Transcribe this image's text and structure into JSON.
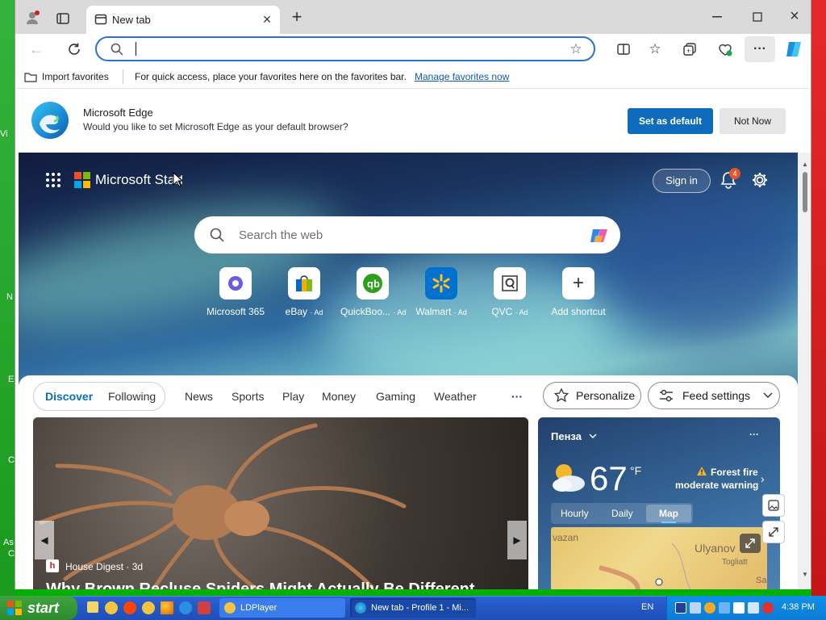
{
  "browser": {
    "tab_title": "New tab",
    "address_value": "",
    "favorites_bar": {
      "import_label": "Import favorites",
      "message": "For quick access, place your favorites here on the favorites bar.",
      "manage_link": "Manage favorites now"
    },
    "default_prompt": {
      "title": "Microsoft Edge",
      "message": "Would you like to set Microsoft Edge as your default browser?",
      "set_default_label": "Set as default",
      "not_now_label": "Not Now"
    }
  },
  "newtab": {
    "brand": "Microsoft Start",
    "sign_in_label": "Sign in",
    "notification_count": "4",
    "search_placeholder": "Search the web",
    "shortcuts": [
      {
        "label": "Microsoft 365",
        "ad": ""
      },
      {
        "label": "eBay",
        "ad": "· Ad"
      },
      {
        "label": "QuickBoo...",
        "ad": "· Ad"
      },
      {
        "label": "Walmart",
        "ad": "· Ad"
      },
      {
        "label": "QVC",
        "ad": "· Ad"
      },
      {
        "label": "Add shortcut",
        "ad": ""
      }
    ],
    "feed": {
      "tabs": [
        "Discover",
        "Following",
        "News",
        "Sports",
        "Play",
        "Money",
        "Gaming",
        "Weather"
      ],
      "more_label": "···",
      "personalize_label": "Personalize",
      "feed_settings_label": "Feed settings",
      "article_source": "House Digest · 3d",
      "article_title": "Why Brown Recluse Spiders Might Actually Be Different"
    },
    "weather": {
      "location": "Пенза",
      "temperature": "67",
      "unit": "°F",
      "alert_line1": "Forest fire",
      "alert_line2": "moderate warning",
      "tabs": [
        "Hourly",
        "Daily",
        "Map"
      ],
      "map_labels": [
        "vazan",
        "Ulyanov",
        "Togliatt",
        "Sa"
      ]
    }
  },
  "taskbar": {
    "start_label": "start",
    "tasks": [
      "LDPlayer",
      "New tab - Profile 1 - Mi..."
    ],
    "language": "EN",
    "clock": "4:38 PM"
  },
  "desktop_fragments": [
    "Vi",
    "N",
    "E",
    "C",
    "As",
    "C"
  ]
}
